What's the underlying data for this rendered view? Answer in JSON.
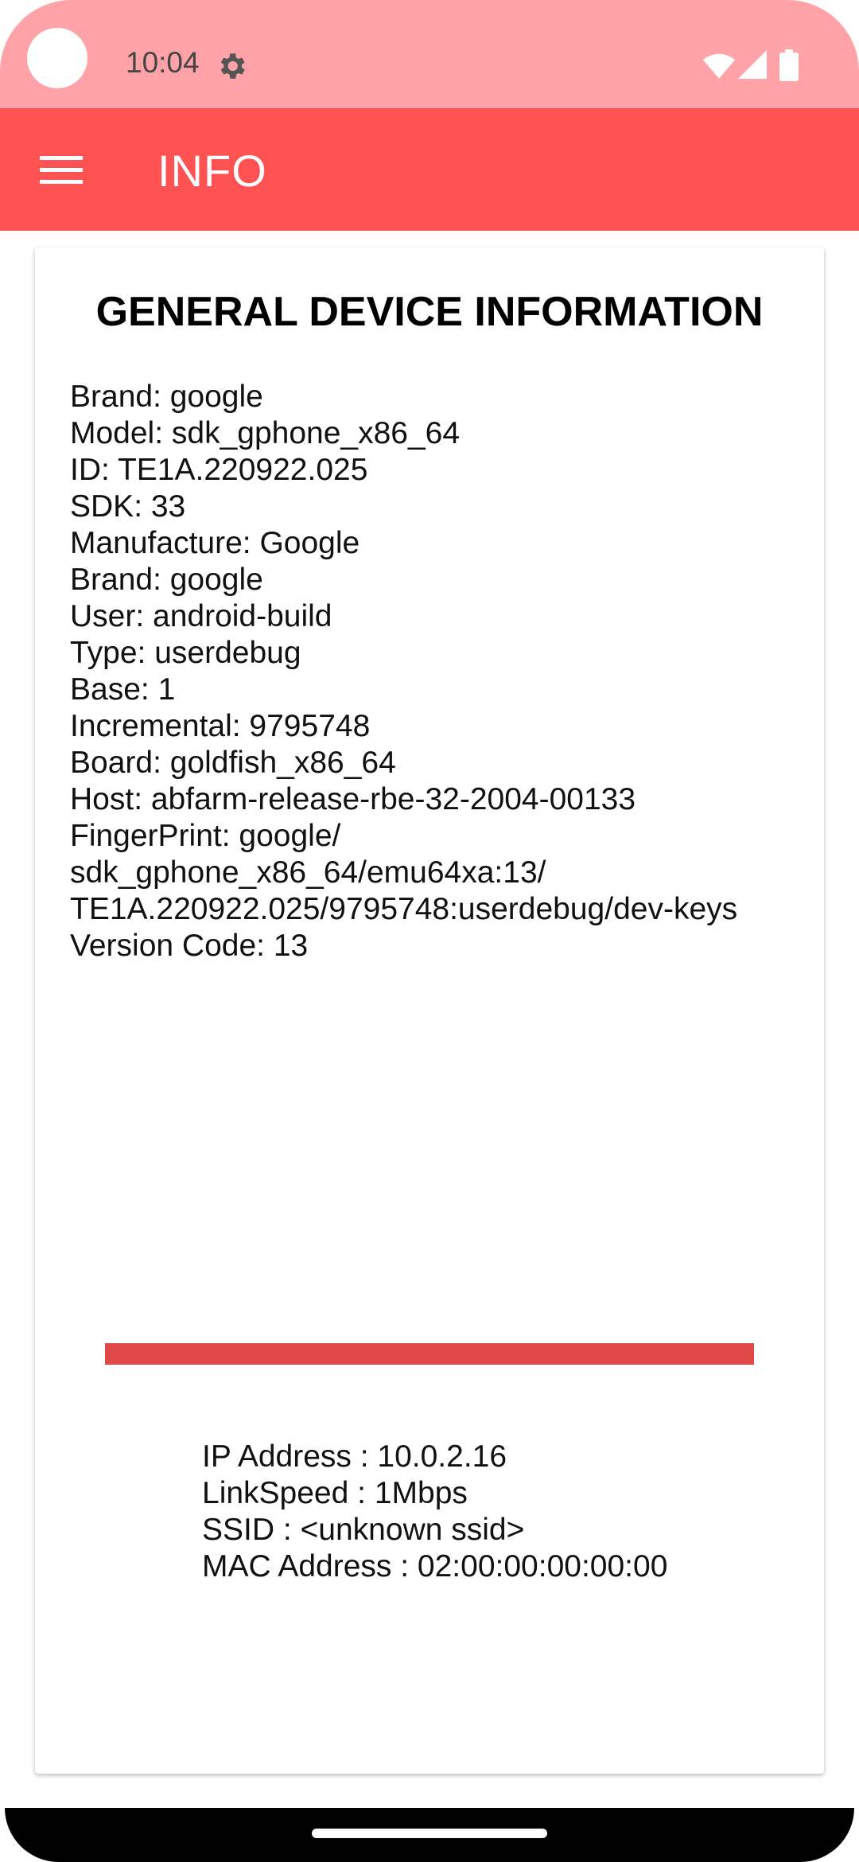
{
  "status_bar": {
    "time": "10:04",
    "icons": [
      "settings-icon",
      "wifi-icon",
      "signal-icon",
      "battery-icon"
    ]
  },
  "app_bar": {
    "title": "INFO",
    "menu_icon": "menu-icon"
  },
  "colors": {
    "status_bar": "#ffa3a8",
    "app_bar": "#ff5252",
    "divider": "#e04848"
  },
  "general_info": {
    "heading": "GENERAL DEVICE INFORMATION",
    "lines": [
      "Brand: google",
      "Model: sdk_gphone_x86_64",
      "ID: TE1A.220922.025",
      "SDK: 33",
      "Manufacture: Google",
      "Brand: google",
      "User: android-build",
      "Type: userdebug",
      "Base: 1",
      "Incremental: 9795748",
      "Board: goldfish_x86_64",
      "Host: abfarm-release-rbe-32-2004-00133",
      "FingerPrint: google/",
      "sdk_gphone_x86_64/emu64xa:13/",
      "TE1A.220922.025/9795748:userdebug/dev-keys",
      "Version Code: 13"
    ]
  },
  "network_info": {
    "lines": [
      "IP Address : 10.0.2.16",
      "LinkSpeed : 1Mbps",
      "SSID : <unknown ssid>",
      "MAC Address : 02:00:00:00:00:00"
    ]
  }
}
